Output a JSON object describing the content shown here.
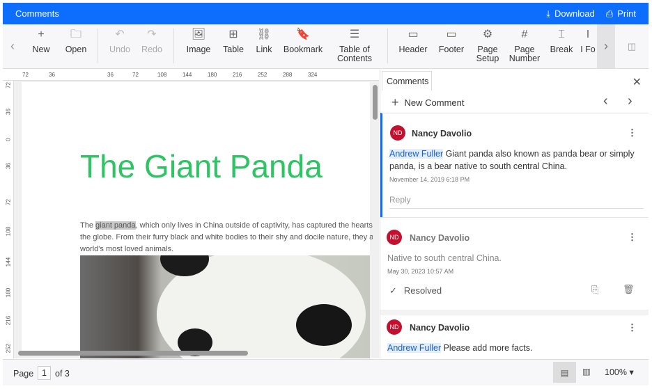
{
  "title": "Comments",
  "actions": {
    "download": "Download",
    "print": "Print"
  },
  "toolbar": [
    {
      "label": "New",
      "icon": "plus-icon",
      "glyph": "+"
    },
    {
      "label": "Open",
      "icon": "folder-icon",
      "glyph": "🗀"
    },
    {
      "label": "Undo",
      "icon": "undo-icon",
      "glyph": "↶",
      "disabled": true
    },
    {
      "label": "Redo",
      "icon": "redo-icon",
      "glyph": "↷",
      "disabled": true
    },
    {
      "label": "Image",
      "icon": "image-icon",
      "glyph": "🖼"
    },
    {
      "label": "Table",
      "icon": "table-icon",
      "glyph": "⊞"
    },
    {
      "label": "Link",
      "icon": "link-icon",
      "glyph": "⛓"
    },
    {
      "label": "Bookmark",
      "icon": "bookmark-icon",
      "glyph": "🔖"
    },
    {
      "label": "Table of Contents",
      "icon": "toc-icon",
      "glyph": "☰"
    },
    {
      "label": "Header",
      "icon": "header-icon",
      "glyph": "▭"
    },
    {
      "label": "Footer",
      "icon": "footer-icon",
      "glyph": "▭"
    },
    {
      "label": "Page Setup",
      "icon": "page-setup-icon",
      "glyph": "⚙"
    },
    {
      "label": "Page Number",
      "icon": "page-number-icon",
      "glyph": "#"
    },
    {
      "label": "Break",
      "icon": "break-icon",
      "glyph": "⌶"
    },
    {
      "label": "I Fo",
      "icon": "field-icon",
      "glyph": "I"
    }
  ],
  "ruler": {
    "h": [
      "72",
      "36",
      "36",
      "72",
      "108",
      "144",
      "180",
      "216",
      "252",
      "288",
      "324"
    ],
    "v": [
      "72",
      "36",
      "0",
      "36",
      "72",
      "108",
      "144",
      "180",
      "216",
      "252"
    ]
  },
  "document": {
    "heading": "The Giant Panda",
    "para_pre": "The ",
    "para_hl": "giant panda",
    "para_l1": ", which only lives in China outside of captivity, has captured the hearts of people around",
    "para_l2": "the globe. From their furry black and white bodies to their shy and docile nature, they are the",
    "para_l3": "world's most loved animals."
  },
  "panel": {
    "tab": "Comments",
    "new_comment": "New Comment",
    "comments": [
      {
        "initials": "ND",
        "author": "Nancy Davolio",
        "mention": "Andrew Fuller",
        "text": " Giant panda also known as panda bear or simply panda, is a bear native to south central China.",
        "date": "November 14, 2019 6:18 PM",
        "reply": "Reply"
      },
      {
        "initials": "ND",
        "author": "Nancy Davolio",
        "text": "Native to south central China.",
        "date": "May 30, 2023 10:57 AM",
        "resolved": "Resolved"
      },
      {
        "initials": "ND",
        "author": "Nancy Davolio",
        "mention": "Andrew Fuller",
        "text": " Please add more facts."
      }
    ]
  },
  "status": {
    "page_label": "Page",
    "page": "1",
    "of": "of 3",
    "zoom": "100%"
  },
  "colors": {
    "accent": "#0d6efd",
    "heading": "#2ec464",
    "avatar": "#c3102f"
  }
}
